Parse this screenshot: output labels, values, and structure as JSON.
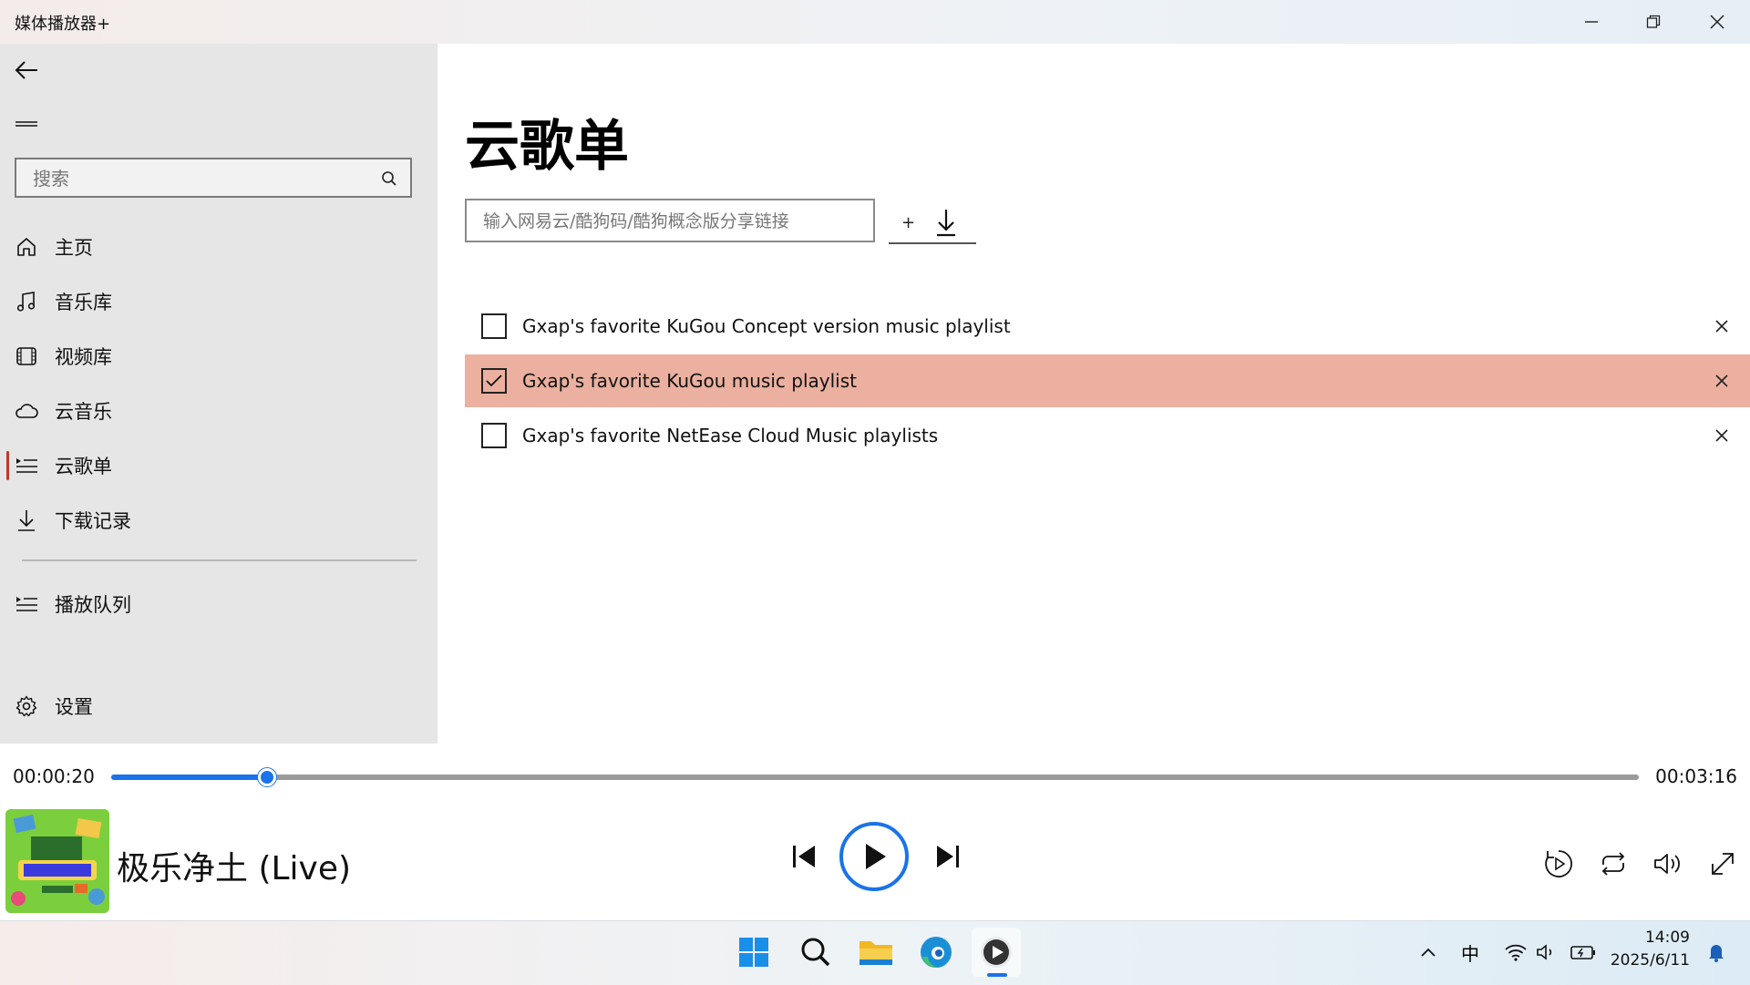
{
  "window": {
    "title": "媒体播放器+",
    "minimize_icon": "minimize-icon",
    "maximize_icon": "restore-icon",
    "close_icon": "close-icon"
  },
  "sidebar": {
    "search_placeholder": "搜索",
    "items": [
      {
        "label": "主页",
        "icon": "home-icon"
      },
      {
        "label": "音乐库",
        "icon": "music-note-icon"
      },
      {
        "label": "视频库",
        "icon": "film-icon"
      },
      {
        "label": "云音乐",
        "icon": "cloud-icon"
      },
      {
        "label": "云歌单",
        "icon": "playlist-icon",
        "active": true
      },
      {
        "label": "下载记录",
        "icon": "download-icon"
      }
    ],
    "queue_label": "播放队列",
    "settings_label": "设置"
  },
  "main": {
    "title": "云歌单",
    "link_placeholder": "输入网易云/酷狗码/酷狗概念版分享链接",
    "add_label": "+",
    "playlists": [
      {
        "name": "Gxap's favorite KuGou Concept version music playlist",
        "checked": false
      },
      {
        "name": "Gxap's favorite KuGou music playlist",
        "checked": true
      },
      {
        "name": "Gxap's favorite NetEase Cloud Music playlists",
        "checked": false
      }
    ]
  },
  "player": {
    "elapsed": "00:00:20",
    "duration": "00:03:16",
    "progress": 0.102,
    "track_title": "极乐净土 (Live)",
    "accent_color": "#1a73e8"
  },
  "taskbar": {
    "ime": "中",
    "time": "14:09",
    "date": "2025/6/11"
  },
  "colors": {
    "selected_row": "#ebb09f",
    "sidebar_bg": "#e6e6e6",
    "active_indicator": "#c0392b"
  }
}
